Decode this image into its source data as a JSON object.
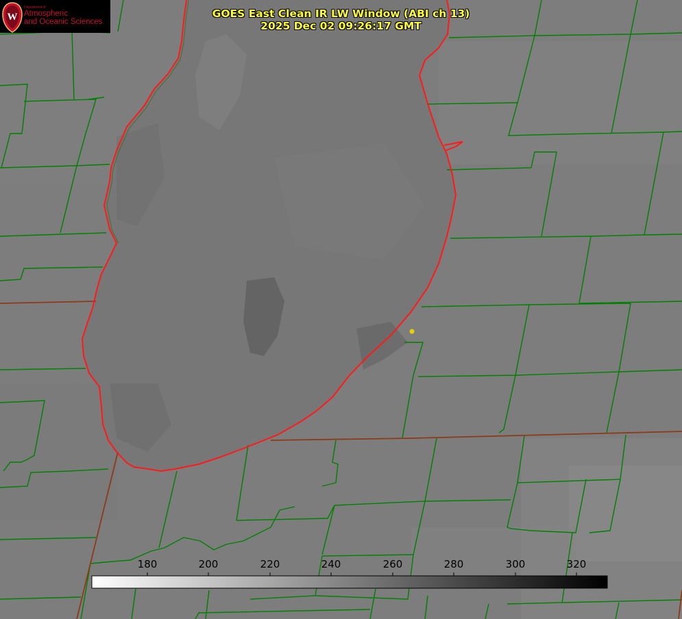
{
  "logo": {
    "department": "Department of",
    "line1": "Atmospheric",
    "line2": "and Oceanic Sciences",
    "mark": "W",
    "icon": "uw-crest-icon"
  },
  "title": {
    "line1": "GOES East Clean IR LW Window (ABI ch 13)",
    "line2": "2025 Dec 02 09:26:17 GMT"
  },
  "colorbar": {
    "ticks": [
      "180",
      "200",
      "220",
      "240",
      "260",
      "280",
      "300",
      "320"
    ],
    "gradient_from": "#ffffff",
    "gradient_to": "#000000"
  },
  "colors": {
    "background": "#7d7d7d",
    "lake": "#767676",
    "county_lines": "#008000",
    "state_lines": "#8b3a1a",
    "shoreline": "#ff1a1a",
    "station_marker": "#e6d000",
    "title_text": "#ffff33"
  }
}
